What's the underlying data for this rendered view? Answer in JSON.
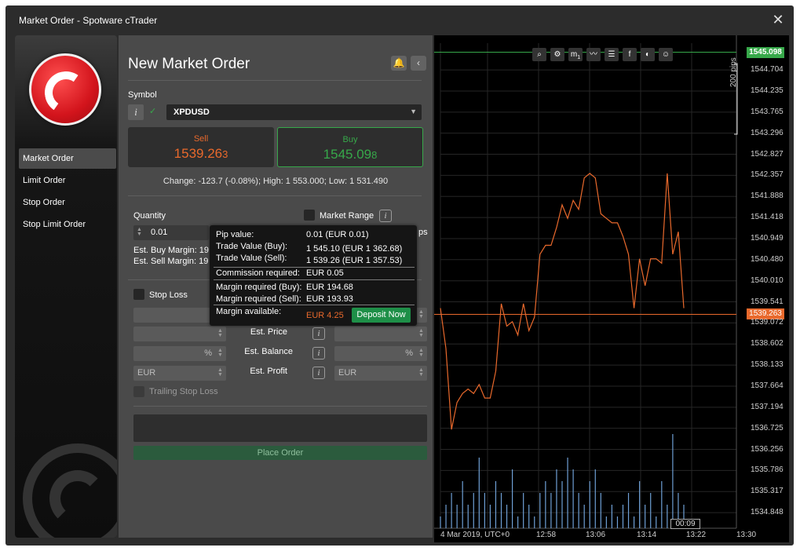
{
  "window": {
    "title": "Market Order - Spotware cTrader"
  },
  "sidebar": {
    "items": [
      {
        "label": "Market Order",
        "active": true
      },
      {
        "label": "Limit Order",
        "active": false
      },
      {
        "label": "Stop Order",
        "active": false
      },
      {
        "label": "Stop Limit Order",
        "active": false
      }
    ]
  },
  "form": {
    "heading": "New Market Order",
    "symbol_label": "Symbol",
    "symbol_value": "XPDUSD",
    "sell_label": "Sell",
    "sell_price": "1539.26",
    "sell_pip": "3",
    "buy_label": "Buy",
    "buy_price": "1545.09",
    "buy_pip": "8",
    "change_text": "Change: -123.7 (-0.08%); High: 1 553.000; Low: 1 531.490",
    "quantity_label": "Quantity",
    "quantity_value": "0.01",
    "market_range_label": "Market Range",
    "pips_suffix": "ps",
    "est_buy_margin": "Est. Buy Margin: 19",
    "est_sell_margin": "Est. Sell Margin: 19",
    "stop_loss_label": "Stop Loss",
    "est_price_label": "Est. Price",
    "est_balance_label": "Est. Balance",
    "est_profit_label": "Est. Profit",
    "percent_symbol": "%",
    "currency": "EUR",
    "trailing_stop_label": "Trailing Stop Loss",
    "place_order_label": "Place Order"
  },
  "tooltip": {
    "pip_value_label": "Pip value:",
    "pip_value": "0.01 (EUR 0.01)",
    "trade_value_buy_label": "Trade Value (Buy):",
    "trade_value_buy": "1 545.10 (EUR 1 362.68)",
    "trade_value_sell_label": "Trade Value (Sell):",
    "trade_value_sell": "1 539.26 (EUR 1 357.53)",
    "commission_label": "Commission required:",
    "commission": "EUR 0.05",
    "margin_buy_label": "Margin required (Buy):",
    "margin_buy": "EUR 194.68",
    "margin_sell_label": "Margin required (Sell):",
    "margin_sell": "EUR 193.93",
    "margin_available_label": "Margin available:",
    "margin_available": "EUR 4.25",
    "deposit_label": "Deposit Now"
  },
  "chart": {
    "toolbar": [
      "zoom-icon",
      "chart-settings-icon",
      "m1-timeframe-icon",
      "indicators-icon",
      "object-list-icon",
      "facebook-icon",
      "theme-icon",
      "user-icon"
    ],
    "timeframe_label": "m",
    "timeframe_sub": "1",
    "pips_label": "200 pips",
    "footer_time_label": "00:09"
  },
  "chart_data": {
    "type": "line",
    "series": [
      {
        "values": [
          1539.4,
          1538.5,
          1536.7,
          1537.3,
          1537.5,
          1537.6,
          1537.5,
          1537.7,
          1537.4,
          1537.4,
          1538.0,
          1539.5,
          1539.0,
          1539.1,
          1538.8,
          1539.5,
          1538.9,
          1539.2,
          1540.6,
          1540.8,
          1540.8,
          1541.2,
          1541.7,
          1541.4,
          1541.8,
          1541.6,
          1542.3,
          1542.4,
          1542.3,
          1541.5,
          1541.4,
          1541.3,
          1541.3,
          1541.0,
          1540.6,
          1539.4,
          1540.5,
          1539.9,
          1540.5,
          1540.5,
          1540.4,
          1542.4,
          1540.6,
          1541.1,
          1539.4
        ],
        "color": "#e9692c"
      }
    ],
    "volume": [
      1,
      2,
      3,
      2,
      4,
      2,
      3,
      6,
      3,
      2,
      4,
      3,
      2,
      5,
      1,
      3,
      2,
      1,
      3,
      4,
      3,
      5,
      4,
      6,
      5,
      3,
      2,
      4,
      5,
      3,
      1,
      2,
      1,
      2,
      3,
      1,
      4,
      2,
      3,
      1,
      4,
      2,
      8,
      3,
      2
    ],
    "y_ticks": [
      "1545.098",
      "1544.704",
      "1544.235",
      "1543.765",
      "1543.296",
      "1542.827",
      "1542.357",
      "1541.888",
      "1541.418",
      "1540.949",
      "1540.480",
      "1540.010",
      "1539.541",
      "1539.263",
      "1539.072",
      "1538.602",
      "1538.133",
      "1537.664",
      "1537.194",
      "1536.725",
      "1536.256",
      "1535.786",
      "1535.317",
      "1534.848"
    ],
    "x_ticks": [
      "4 Mar 2019, UTC+0",
      "12:58",
      "13:06",
      "13:14",
      "13:22",
      "13:30"
    ],
    "ylim": [
      1534.5,
      1545.3
    ],
    "ask_line": 1545.098,
    "bid_line": 1539.263,
    "ask_color": "#37a84a",
    "bid_color": "#e9692c",
    "volume_color": "#6fa0d6",
    "grid": true
  },
  "colors": {
    "sell": "#e9692c",
    "buy": "#37a84a",
    "deposit": "#1e8f48",
    "margin_available": "#e9692c"
  }
}
